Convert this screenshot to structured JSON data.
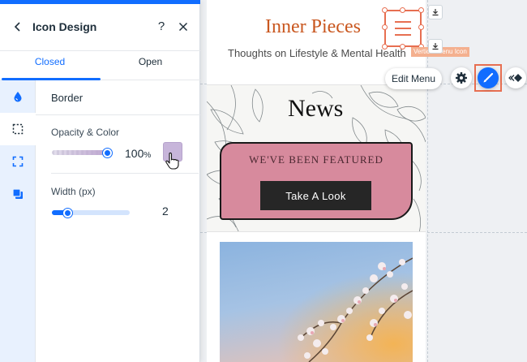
{
  "canvas": {
    "site_title": "Inner Pieces",
    "site_tagline": "Thoughts on Lifestyle & Mental Health",
    "news_title": "News",
    "featured_text": "WE'VE BEEN FEATURED",
    "take_look_label": "Take A Look",
    "selection_label": "Vertical Menu Icon",
    "edit_menu_label": "Edit Menu",
    "icons": {
      "settings": "gear-icon",
      "design": "brush-icon",
      "animation": "animation-icon",
      "download": "download-icon",
      "menu": "hamburger-icon"
    }
  },
  "panel": {
    "title": "Icon Design",
    "help_label": "?",
    "tabs": [
      {
        "label": "Closed",
        "active": true
      },
      {
        "label": "Open",
        "active": false
      }
    ],
    "rail_icons": [
      "fill-drop-icon",
      "border-icon",
      "corners-icon",
      "shadow-icon"
    ],
    "active_rail": "border-icon",
    "section_title": "Border",
    "opacity_color": {
      "label": "Opacity & Color",
      "value": "100",
      "unit": "%",
      "opacity_level": 1.0,
      "swatch_color": "#c7b5da"
    },
    "width": {
      "label": "Width (px)",
      "value": "2",
      "level": 0.2
    }
  },
  "colors": {
    "accent": "#116dff",
    "selection": "#e76f51",
    "site_title": "#c9571f",
    "featured_box": "#d78a9d"
  }
}
